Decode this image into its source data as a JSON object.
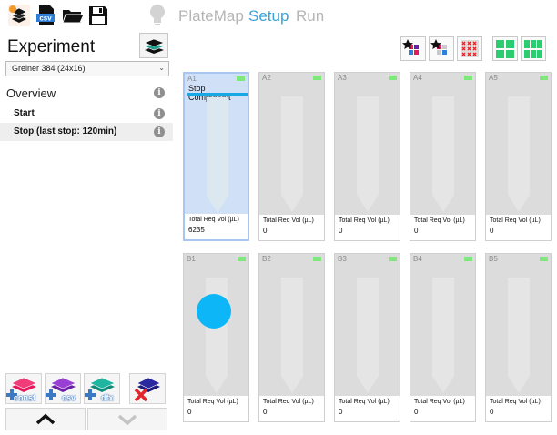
{
  "toolbar": {
    "left_buttons": [
      {
        "icon": "open-experiment-icon"
      },
      {
        "icon": "csv-icon",
        "label": "csv"
      },
      {
        "icon": "folder-open-icon"
      },
      {
        "icon": "save-icon"
      }
    ],
    "hint_icon": "lightbulb-icon",
    "nav_tabs": [
      {
        "label": "PlateMap",
        "active": false
      },
      {
        "label": "Setup",
        "active": true
      },
      {
        "label": "Run",
        "active": false
      }
    ]
  },
  "sidebar": {
    "title": "Experiment",
    "plate_select": {
      "value": "Greiner 384  (24x16)"
    },
    "overview_label": "Overview",
    "steps": [
      {
        "label": "Start",
        "selected": false
      },
      {
        "label": "Stop (last stop: 120min)",
        "selected": true
      }
    ],
    "bottom_buttons": [
      {
        "icon": "add-constant-icon",
        "label": "const"
      },
      {
        "icon": "add-csv-icon",
        "label": "csv"
      },
      {
        "icon": "add-dfx-icon",
        "label": "dfx"
      },
      {
        "icon": "delete-icon"
      }
    ]
  },
  "grid_tools": [
    {
      "icon": "star-components-icon"
    },
    {
      "icon": "star-single-icon"
    },
    {
      "icon": "clear-wells-icon"
    },
    {
      "icon": "layout-two-columns-icon"
    },
    {
      "icon": "layout-three-columns-icon"
    }
  ],
  "wells": [
    {
      "id": "A1",
      "component": "Stop Component",
      "vol_label": "Total Req Vol (µL)",
      "vol": "6235",
      "selected": true,
      "dot": false
    },
    {
      "id": "A2",
      "component": "",
      "vol_label": "Total Req Vol (µL)",
      "vol": "0",
      "selected": false,
      "dot": false
    },
    {
      "id": "A3",
      "component": "",
      "vol_label": "Total Req Vol (µL)",
      "vol": "0",
      "selected": false,
      "dot": false
    },
    {
      "id": "A4",
      "component": "",
      "vol_label": "Total Req Vol (µL)",
      "vol": "0",
      "selected": false,
      "dot": false
    },
    {
      "id": "A5",
      "component": "",
      "vol_label": "Total Req Vol (µL)",
      "vol": "0",
      "selected": false,
      "dot": false
    },
    {
      "id": "B1",
      "component": "",
      "vol_label": "Total Req Vol (µL)",
      "vol": "0",
      "selected": false,
      "dot": true
    },
    {
      "id": "B2",
      "component": "",
      "vol_label": "Total Req Vol (µL)",
      "vol": "0",
      "selected": false,
      "dot": false
    },
    {
      "id": "B3",
      "component": "",
      "vol_label": "Total Req Vol (µL)",
      "vol": "0",
      "selected": false,
      "dot": false
    },
    {
      "id": "B4",
      "component": "",
      "vol_label": "Total Req Vol (µL)",
      "vol": "0",
      "selected": false,
      "dot": false
    },
    {
      "id": "B5",
      "component": "",
      "vol_label": "Total Req Vol (µL)",
      "vol": "0",
      "selected": false,
      "dot": false
    }
  ],
  "colors": {
    "accent": "#3aa1d6",
    "component_bar": "#18a8e6",
    "dot": "#0db6f6",
    "status_led": "#7ee87a",
    "selected_card": "#cfe0f7"
  }
}
